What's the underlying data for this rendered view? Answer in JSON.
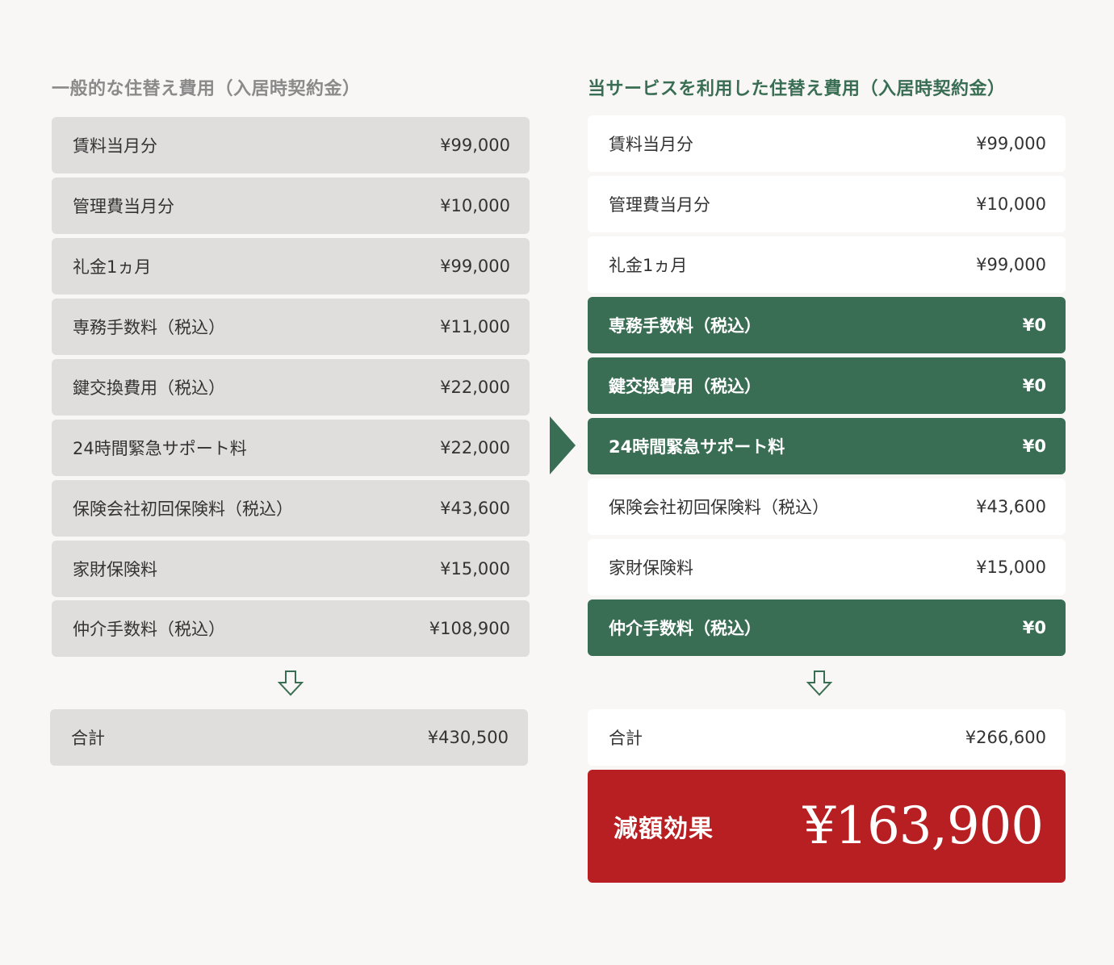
{
  "left": {
    "heading": "一般的な住替え費用（入居時契約金）",
    "rows": [
      {
        "label": "賃料当月分",
        "amount": "¥99,000"
      },
      {
        "label": "管理費当月分",
        "amount": "¥10,000"
      },
      {
        "label": "礼金1ヵ月",
        "amount": "¥99,000"
      },
      {
        "label": "専務手数料（税込）",
        "amount": "¥11,000"
      },
      {
        "label": "鍵交換費用（税込）",
        "amount": "¥22,000"
      },
      {
        "label": "24時間緊急サポート料",
        "amount": "¥22,000"
      },
      {
        "label": "保険会社初回保険料（税込）",
        "amount": "¥43,600"
      },
      {
        "label": "家財保険料",
        "amount": "¥15,000"
      },
      {
        "label": "仲介手数料（税込）",
        "amount": "¥108,900"
      }
    ],
    "total": {
      "label": "合計",
      "amount": "¥430,500"
    }
  },
  "right": {
    "heading": "当サービスを利用した住替え費用（入居時契約金）",
    "rows": [
      {
        "label": "賃料当月分",
        "amount": "¥99,000"
      },
      {
        "label": "管理費当月分",
        "amount": "¥10,000"
      },
      {
        "label": "礼金1ヵ月",
        "amount": "¥99,000"
      },
      {
        "label": "専務手数料（税込）",
        "amount": "¥0"
      },
      {
        "label": "鍵交換費用（税込）",
        "amount": "¥0"
      },
      {
        "label": "24時間緊急サポート料",
        "amount": "¥0"
      },
      {
        "label": "保険会社初回保険料（税込）",
        "amount": "¥43,600"
      },
      {
        "label": "家財保険料",
        "amount": "¥15,000"
      },
      {
        "label": "仲介手数料（税込）",
        "amount": "¥0"
      }
    ],
    "total": {
      "label": "合計",
      "amount": "¥266,600"
    },
    "effect": {
      "label": "減額効果",
      "amount": "¥163,900"
    }
  },
  "colors": {
    "background": "#f8f7f5",
    "gray_row": "#dfdedc",
    "white_row": "#ffffff",
    "green_highlight": "#3a6e54",
    "red_effect": "#b81f22",
    "left_heading": "#8a8a8a",
    "right_heading": "#3a6e54"
  },
  "icons": {
    "down_arrow": "arrow-down-outline-icon",
    "comparison_arrow": "triangle-right-icon"
  }
}
